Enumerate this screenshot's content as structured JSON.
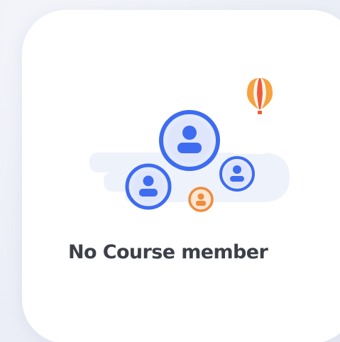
{
  "empty_state": {
    "title": "No Course member",
    "illustration": {
      "icons": [
        "cloud-shape",
        "balloon-icon",
        "user-circle-icon-large",
        "user-circle-icon-left",
        "user-circle-icon-right",
        "user-circle-icon-small"
      ],
      "colors": {
        "primary_blue": "#3e6cf0",
        "light_blue_fill": "#e3eafc",
        "cloud": "#eef2fb",
        "orange": "#f08a3c",
        "balloon_red": "#ee5a3a"
      }
    }
  }
}
